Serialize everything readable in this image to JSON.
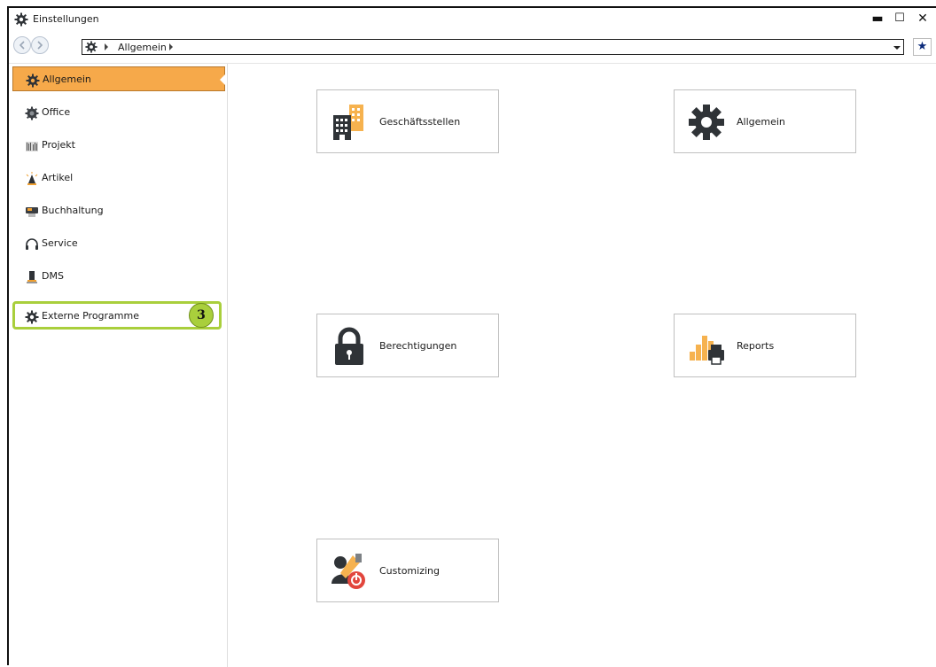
{
  "window": {
    "title": "Einstellungen",
    "minimize": "▬",
    "maximize": "☐",
    "close": "✕"
  },
  "toolbar": {
    "back_icon": "back-arrow-icon",
    "forward_icon": "forward-arrow-icon",
    "breadcrumb": [
      "Allgemein"
    ],
    "favorite_icon": "★"
  },
  "sidebar": {
    "items": [
      {
        "label": "Allgemein",
        "icon": "gear-icon",
        "active": true
      },
      {
        "label": "Office",
        "icon": "gear-dark-icon"
      },
      {
        "label": "Projekt",
        "icon": "project-icon"
      },
      {
        "label": "Artikel",
        "icon": "article-icon"
      },
      {
        "label": "Buchhaltung",
        "icon": "accounting-icon"
      },
      {
        "label": "Service",
        "icon": "headset-icon"
      },
      {
        "label": "DMS",
        "icon": "dms-icon"
      },
      {
        "label": "Externe Programme",
        "icon": "gear-icon"
      }
    ],
    "highlight_badge": "3"
  },
  "tiles": [
    {
      "label": "Geschäftsstellen",
      "icon": "buildings-icon"
    },
    {
      "label": "Allgemein",
      "icon": "gear-large-icon"
    },
    {
      "label": "Berechtigungen",
      "icon": "lock-icon"
    },
    {
      "label": "Reports",
      "icon": "reports-printer-icon"
    },
    {
      "label": "Customizing",
      "icon": "customizing-icon"
    }
  ],
  "colors": {
    "accent_orange": "#f6a94a",
    "highlight_green": "#a9cf3c",
    "icon_dark": "#2f3337"
  }
}
